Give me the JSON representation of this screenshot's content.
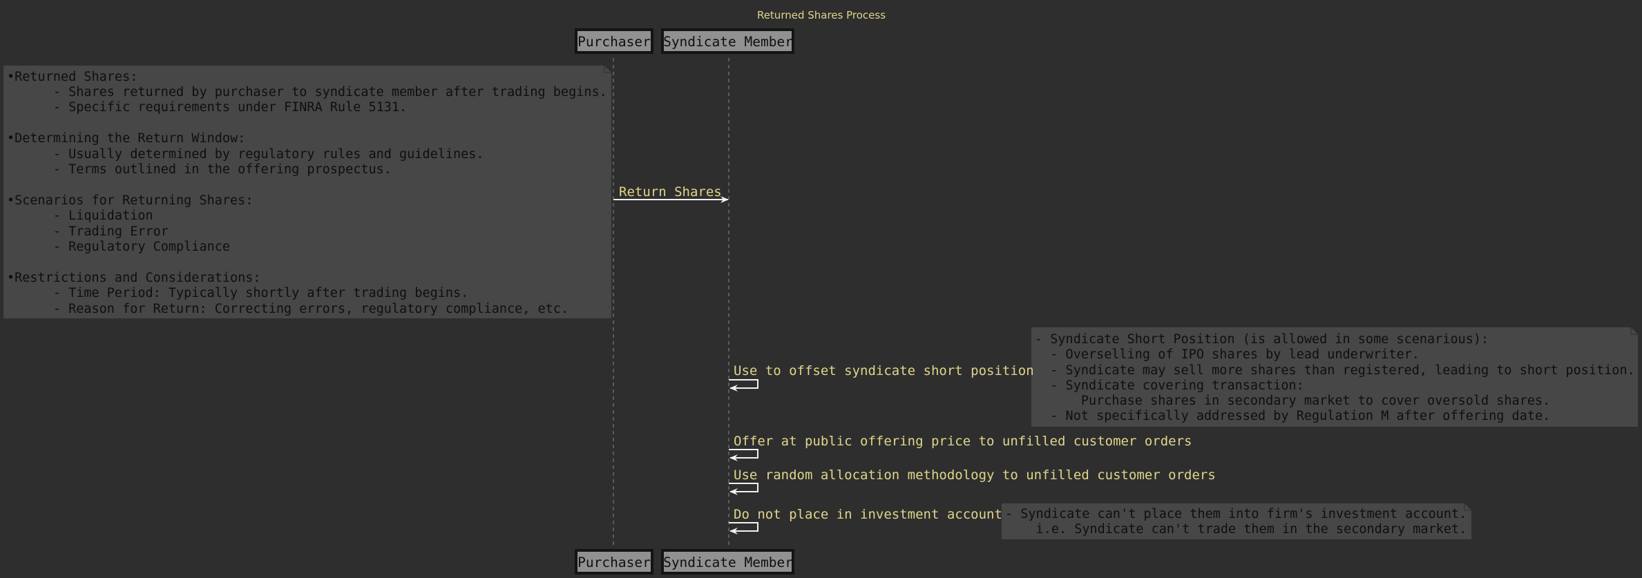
{
  "title": "Returned Shares Process",
  "participants": [
    "Purchaser",
    "Syndicate Member"
  ],
  "messages": [
    {
      "from": "Purchaser",
      "to": "Syndicate Member",
      "text": "Return Shares"
    },
    {
      "from": "Syndicate Member",
      "to": "Syndicate Member",
      "text": "Use to offset syndicate short position"
    },
    {
      "from": "Syndicate Member",
      "to": "Syndicate Member",
      "text": "Offer at public offering price to unfilled customer orders"
    },
    {
      "from": "Syndicate Member",
      "to": "Syndicate Member",
      "text": "Use random allocation methodology to unfilled customer orders"
    },
    {
      "from": "Syndicate Member",
      "to": "Syndicate Member",
      "text": "Do not place in investment account"
    }
  ],
  "notes": [
    {
      "lines": [
        "•Returned Shares:",
        "      - Shares returned by purchaser to syndicate member after trading begins.",
        "      - Specific requirements under FINRA Rule 5131.",
        "",
        "•Determining the Return Window:",
        "      - Usually determined by regulatory rules and guidelines.",
        "      - Terms outlined in the offering prospectus.",
        "",
        "•Scenarios for Returning Shares:",
        "      - Liquidation",
        "      - Trading Error",
        "      - Regulatory Compliance",
        "",
        "•Restrictions and Considerations:",
        "      - Time Period: Typically shortly after trading begins.",
        "      - Reason for Return: Correcting errors, regulatory compliance, etc."
      ]
    },
    {
      "lines": [
        "- Syndicate Short Position (is allowed in some scenarious):",
        "  - Overselling of IPO shares by lead underwriter.",
        "  - Syndicate may sell more shares than registered, leading to short position.",
        "  - Syndicate covering transaction:",
        "      Purchase shares in secondary market to cover oversold shares.",
        "  - Not specifically addressed by Regulation M after offering date."
      ]
    },
    {
      "lines": [
        "- Syndicate can't place them into firm's investment account.",
        "    i.e. Syndicate can't trade them in the secondary market."
      ]
    }
  ],
  "colors": {
    "background": "#2e2e2e",
    "participant_fill": "#919191",
    "participant_border": "#141414",
    "note_fill": "#474747",
    "message_text": "#e0d58c",
    "arrow": "#f2f2f2"
  }
}
